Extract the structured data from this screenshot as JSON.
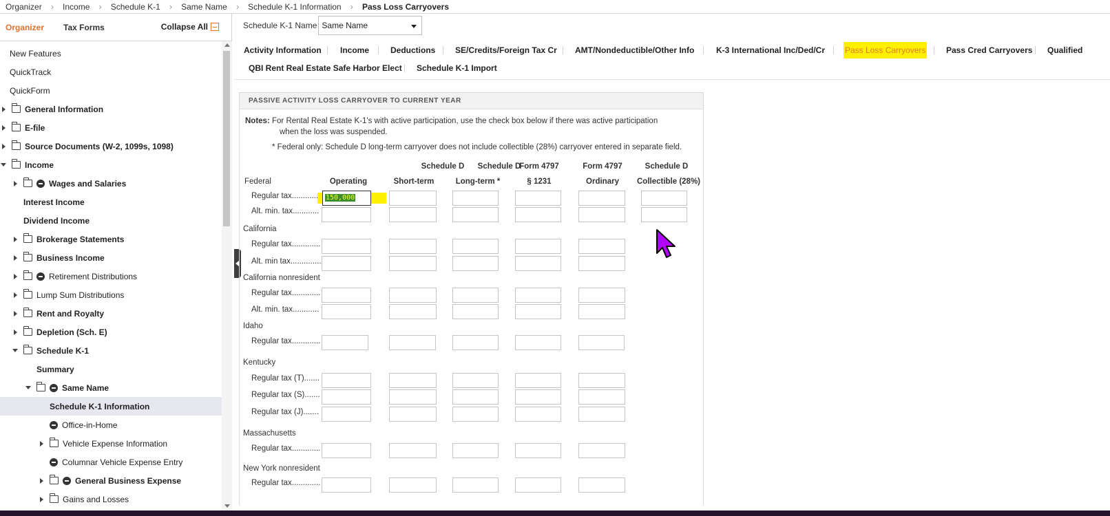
{
  "breadcrumb": [
    "Organizer",
    "Income",
    "Schedule K-1",
    "Same Name",
    "Schedule K-1 Information",
    "Pass Loss Carryovers"
  ],
  "left_tabs": {
    "organizer": "Organizer",
    "tax_forms": "Tax Forms",
    "collapse_all": "Collapse All"
  },
  "tree": [
    {
      "label": "New Features"
    },
    {
      "label": "QuickTrack"
    },
    {
      "label": "QuickForm"
    },
    {
      "label": "General Information"
    },
    {
      "label": "E-file"
    },
    {
      "label": "Source Documents (W-2, 1099s, 1098)"
    },
    {
      "label": "Income"
    },
    {
      "label": "Wages and Salaries"
    },
    {
      "label": "Interest Income"
    },
    {
      "label": "Dividend Income"
    },
    {
      "label": "Brokerage Statements"
    },
    {
      "label": "Business Income"
    },
    {
      "label": "Retirement Distributions"
    },
    {
      "label": "Lump Sum Distributions"
    },
    {
      "label": "Rent and Royalty"
    },
    {
      "label": "Depletion (Sch. E)"
    },
    {
      "label": "Schedule K-1"
    },
    {
      "label": "Summary"
    },
    {
      "label": "Same Name"
    },
    {
      "label": "Schedule K-1 Information"
    },
    {
      "label": "Office-in-Home"
    },
    {
      "label": "Vehicle Expense Information"
    },
    {
      "label": "Columnar Vehicle Expense Entry"
    },
    {
      "label": "General Business Expense"
    },
    {
      "label": "Gains and Losses"
    }
  ],
  "k1_name": {
    "label": "Schedule K-1 Name",
    "value": "Same Name"
  },
  "tabs_row1": [
    "Activity Information",
    "Income",
    "Deductions",
    "SE/Credits/Foreign Tax Cr",
    "AMT/Nondeductible/Other Info",
    "K-3 International Inc/Ded/Cr",
    "Pass Loss Carryovers",
    "Pass Cred Carryovers",
    "Qualified"
  ],
  "tabs_row2": [
    "QBI Rent Real Estate Safe Harbor Elect",
    "Schedule K-1 Import"
  ],
  "form": {
    "header": "PASSIVE ACTIVITY LOSS CARRYOVER TO CURRENT YEAR",
    "notes_label": "Notes:",
    "note1_line1": "For Rental Real Estate K-1's with active participation, use the check box below if there was active participation",
    "note1_line2": "when the loss was suspended.",
    "note2": "* Federal only: Schedule D long-term carryover does not include collectible (28%) carryover entered in separate field.",
    "col_headers": [
      {
        "top": "",
        "bottom": "Operating"
      },
      {
        "top": "Schedule D",
        "bottom": "Short-term"
      },
      {
        "top": "Schedule D",
        "bottom": "Long-term *"
      },
      {
        "top": "Form 4797",
        "bottom": "§ 1231"
      },
      {
        "top": "Form 4797",
        "bottom": "Ordinary"
      },
      {
        "top": "Schedule D",
        "bottom": "Collectible (28%)"
      }
    ],
    "sections": {
      "federal": "Federal",
      "california": "California",
      "california_nonresident": "California nonresident",
      "idaho": "Idaho",
      "kentucky": "Kentucky",
      "massachusetts": "Massachusetts",
      "new_york_nonresident": "New York nonresident"
    },
    "row_labels": {
      "regular_tax": "Regular tax.............",
      "alt_min_tax": "Alt. min. tax............",
      "alt_min_tax_ca": "Alt. min tax..............",
      "regular_tax_t": "Regular tax (T).......",
      "regular_tax_s": "Regular tax (S).......",
      "regular_tax_j": "Regular tax (J)......."
    },
    "federal_regular_operating_value": "150,000"
  },
  "colors": {
    "accent": "#e8702a",
    "highlight": "#ffef00",
    "cursor": "#b400ff"
  }
}
